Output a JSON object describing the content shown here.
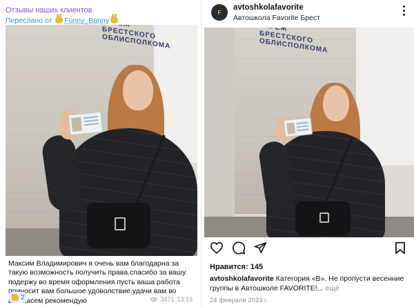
{
  "telegram": {
    "chat_title": "Отзывы наших клиентов",
    "forwarded_prefix": "Переслано от",
    "forwarded_name": "Funny_Bunny",
    "message": "Максим Владимирович я очень вам благодарна за такую возможность получить права.спасибо за вашу подержу во время оформления.пусть ваша работа приносит вам большое удоволствие.удачи вам во всем,всем рекомендую",
    "reaction_count": "2",
    "views": "3471",
    "time": "13:19",
    "icons": [
      "bunny-emoji-icon",
      "thumbs-up-icon",
      "eye-icon"
    ]
  },
  "instagram": {
    "username": "avtoshkolafavorite",
    "location": "Автошкола Favorite Брест",
    "avatar_text": "F",
    "likes_label": "Нравится:",
    "likes_count": "145",
    "caption_user": "avtoshkolafavorite",
    "caption_text": "Категория «В». Не пропусти весенние группы в Автошколе FAVORITE!...",
    "more_label": "ещё",
    "date": "24 февраля 2023 г.",
    "icons": [
      "heart-icon",
      "comment-icon",
      "share-icon",
      "bookmark-icon",
      "more-options-icon"
    ]
  },
  "photo": {
    "building_sign_lines": [
      "УЧРЕЖ",
      "БРЕСТСКОГО",
      "ОБЛИСПОЛКОМА"
    ],
    "colors": {
      "coat": "#222327",
      "hair": "#b97a45",
      "wall": "#c9c4bc",
      "sign": "#2f3a66"
    }
  }
}
